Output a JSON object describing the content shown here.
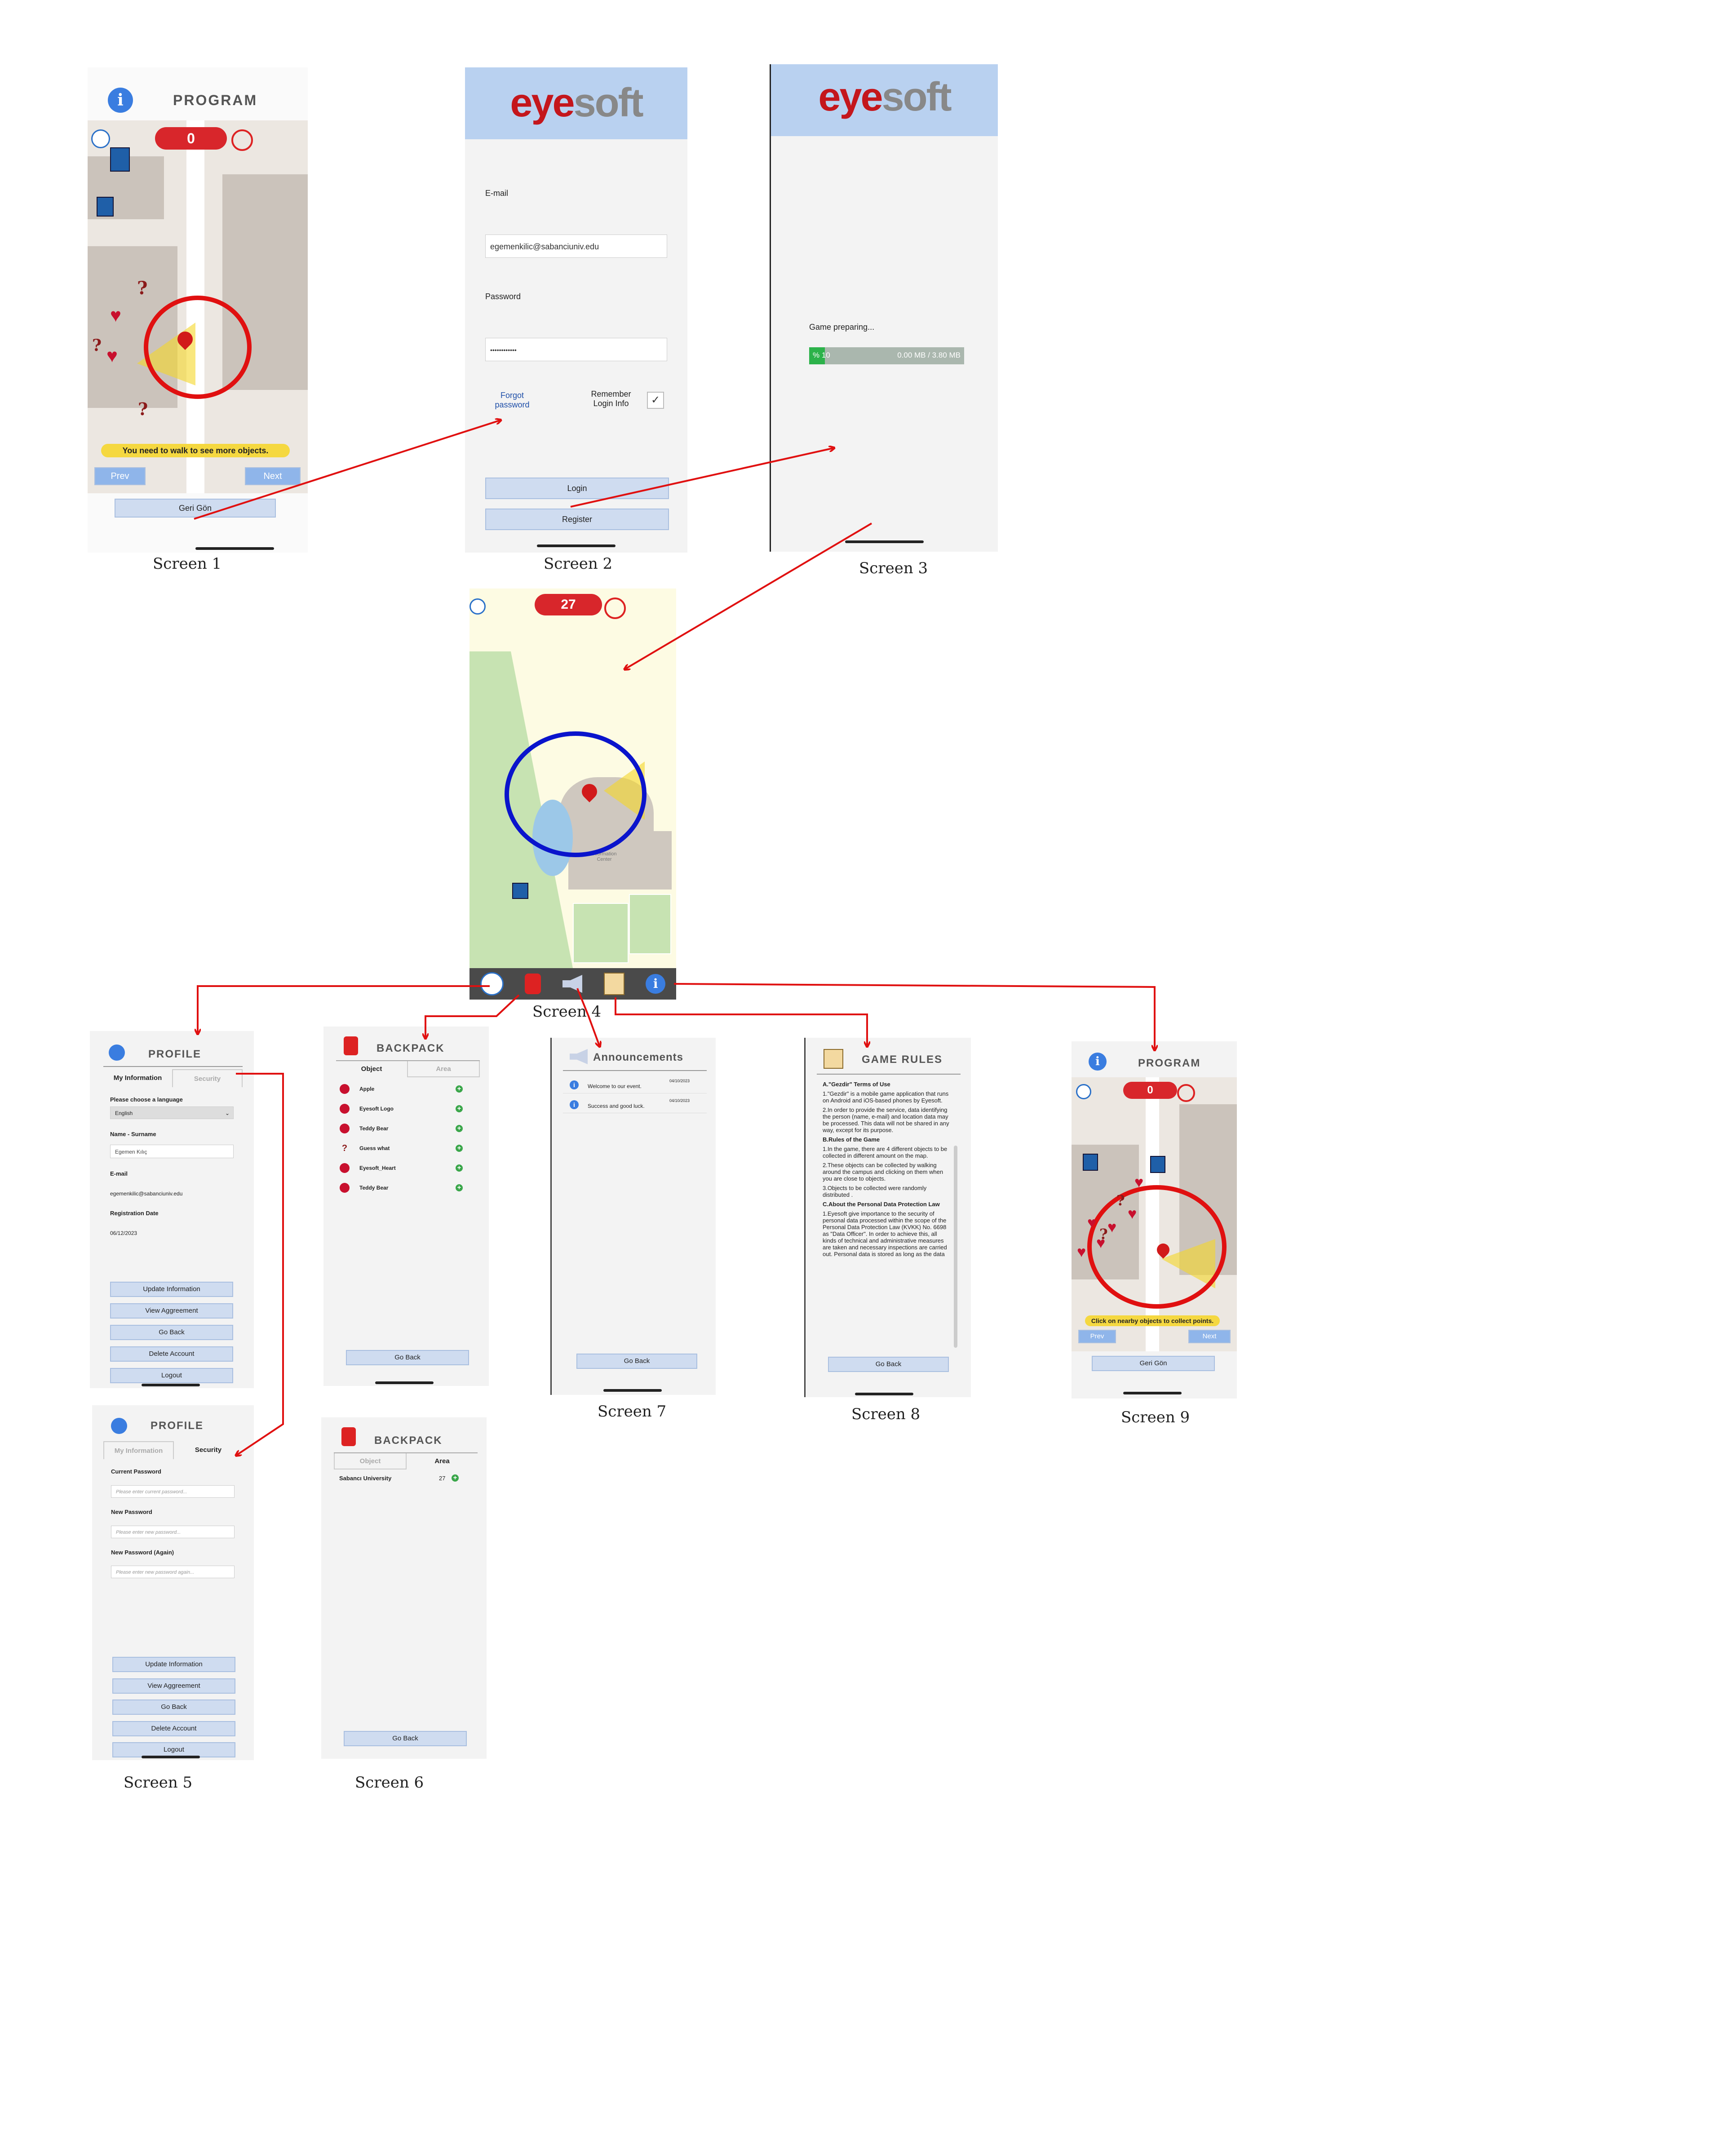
{
  "captions": [
    "Screen 1",
    "Screen 2",
    "Screen 3",
    "Screen 4",
    "Screen 5",
    "Screen 6",
    "Screen 7",
    "Screen 8",
    "Screen 9"
  ],
  "screen1": {
    "title": "PROGRAM",
    "score": "0",
    "banner": "You need to walk to see more objects.",
    "prev": "Prev",
    "next": "Next",
    "back": "Geri Gön"
  },
  "screen2": {
    "logo_a": "eye",
    "logo_b": "soft",
    "email_label": "E-mail",
    "email_value": "egemenkilic@sabanciuniv.edu",
    "password_label": "Password",
    "password_value": "••••••••••••",
    "forgot": "Forgot password",
    "remember": "Remember Login Info",
    "login": "Login",
    "register": "Register"
  },
  "screen3": {
    "logo_a": "eye",
    "logo_b": "soft",
    "preparing": "Game preparing...",
    "percent": "% 10",
    "sizes": "0.00 MB / 3.80 MB",
    "progress": 0.1
  },
  "screen4": {
    "score": "27",
    "building_label": "Information Center",
    "nav_icons": [
      "profile-icon",
      "backpack-icon",
      "announcements-icon",
      "game-rules-icon",
      "info-icon"
    ]
  },
  "screen5a": {
    "title": "PROFILE",
    "tab_info": "My Information",
    "tab_security": "Security",
    "lang_label": "Please choose a language",
    "lang_value": "English",
    "name_label": "Name - Surname",
    "name_value": "Egemen Kılıç",
    "email_label": "E-mail",
    "email_value": "egemenkilic@sabanciuniv.edu",
    "reg_label": "Registration Date",
    "reg_value": "06/12/2023",
    "buttons": [
      "Update Information",
      "View Aggreement",
      "Go Back",
      "Delete Account",
      "Logout"
    ]
  },
  "screen5b": {
    "title": "PROFILE",
    "tab_info": "My Information",
    "tab_security": "Security",
    "current_label": "Current Password",
    "current_ph": "Please enter current password...",
    "new_label": "New Password",
    "new_ph": "Please enter new password...",
    "again_label": "New Password (Again)",
    "again_ph": "Please enter new password again...",
    "buttons": [
      "Update Information",
      "View Aggreement",
      "Go Back",
      "Delete Account",
      "Logout"
    ]
  },
  "screen6a": {
    "title": "BACKPACK",
    "tab_object": "Object",
    "tab_area": "Area",
    "items": [
      {
        "name": "Apple",
        "count": "0",
        "icon": "apple-icon"
      },
      {
        "name": "Eyesoft Logo",
        "count": "0",
        "icon": "logo-icon"
      },
      {
        "name": "Teddy Bear",
        "count": "6",
        "icon": "teddy-icon"
      },
      {
        "name": "Guess what",
        "count": "4",
        "icon": "question-icon"
      },
      {
        "name": "Eyesoft_Heart",
        "count": "17",
        "icon": "heart-icon"
      },
      {
        "name": "Teddy Bear",
        "count": "0",
        "icon": "teddy-icon"
      }
    ],
    "back": "Go Back"
  },
  "screen6b": {
    "title": "BACKPACK",
    "tab_object": "Object",
    "tab_area": "Area",
    "area": "Sabancı University",
    "count": "27",
    "back": "Go Back"
  },
  "screen7": {
    "title": "Announcements",
    "items": [
      {
        "text": "Welcome to our event.",
        "date": "04/10/2023"
      },
      {
        "text": "Success and good luck.",
        "date": "04/10/2023"
      }
    ],
    "back": "Go Back"
  },
  "screen8": {
    "title": "GAME RULES",
    "sections": [
      {
        "heading": "A.\"Gezdir\" Terms of Use",
        "paras": [
          "1.\"Gezdir\" is a mobile game application that runs on Android and iOS-based phones by Eyesoft.",
          "2.In order to provide the service, data identifying the person (name, e-mail) and location data may be processed. This data will not be shared in any way, except for its purpose."
        ]
      },
      {
        "heading": "B.Rules of the Game",
        "paras": [
          "1.In the game, there are 4 different objects to be collected in different amount on the map.",
          "2.These objects can be collected by walking around the campus and clicking on them when you are close to objects.",
          "3.Objects to be collected were randomly distributed ."
        ]
      },
      {
        "heading": "C.About the Personal Data Protection Law",
        "paras": [
          "1.Eyesoft give importance to the security of personal data processed within the scope of the Personal Data Protection Law (KVKK) No. 6698 as \"Data Officer\". In order to achieve this, all kinds of technical and administrative measures are taken and necessary inspections are carried out. Personal data is stored as long as the data"
        ]
      }
    ],
    "back": "Go Back"
  },
  "screen9": {
    "title": "PROGRAM",
    "score": "0",
    "banner": "Click on nearby objects to collect points.",
    "prev": "Prev",
    "next": "Next",
    "back": "Geri Gön"
  }
}
